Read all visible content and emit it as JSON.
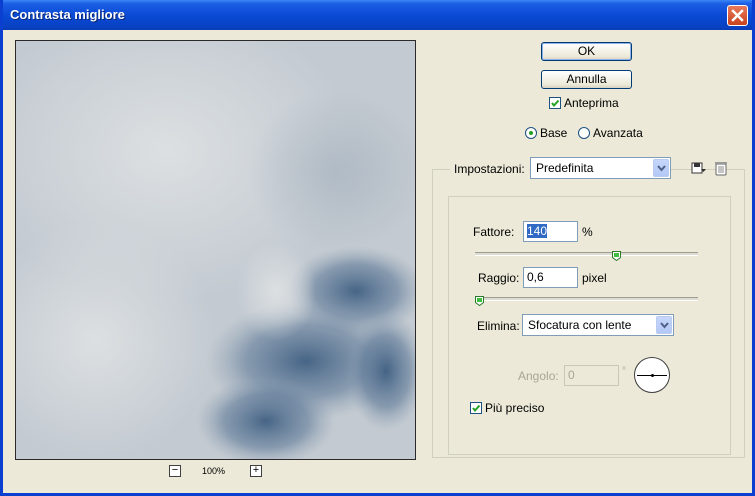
{
  "window": {
    "title": "Contrasta migliore"
  },
  "preview": {
    "zoom_out": "−",
    "zoom_in": "+",
    "zoom_level": "100%"
  },
  "buttons": {
    "ok": "OK",
    "cancel": "Annulla"
  },
  "preview_checkbox": {
    "label": "Anteprima",
    "checked": true
  },
  "mode": {
    "base": "Base",
    "advanced": "Avanzata",
    "selected": "base"
  },
  "settings": {
    "label": "Impostazioni:",
    "value": "Predefinita"
  },
  "amount": {
    "label": "Fattore:",
    "value": "140",
    "unit": "%",
    "level_fraction": 0.64
  },
  "radius": {
    "label": "Raggio:",
    "value": "0,6",
    "unit": "pixel",
    "level_fraction": 0.0
  },
  "remove": {
    "label": "Elimina:",
    "value": "Sfocatura con lente"
  },
  "angle": {
    "label": "Angolo:",
    "value": "0",
    "unit": "°"
  },
  "more_accurate": {
    "label": "Più preciso",
    "checked": true
  },
  "icons": {
    "close": "close-icon",
    "save": "save-settings-icon",
    "delete": "trash-icon",
    "dropdown": "chevron-down-icon",
    "check": "check-icon"
  },
  "colors": {
    "titlebar": "#0a4ad6",
    "dialog_bg": "#ece9d8",
    "check": "#21a121",
    "selection": "#316ac5"
  }
}
